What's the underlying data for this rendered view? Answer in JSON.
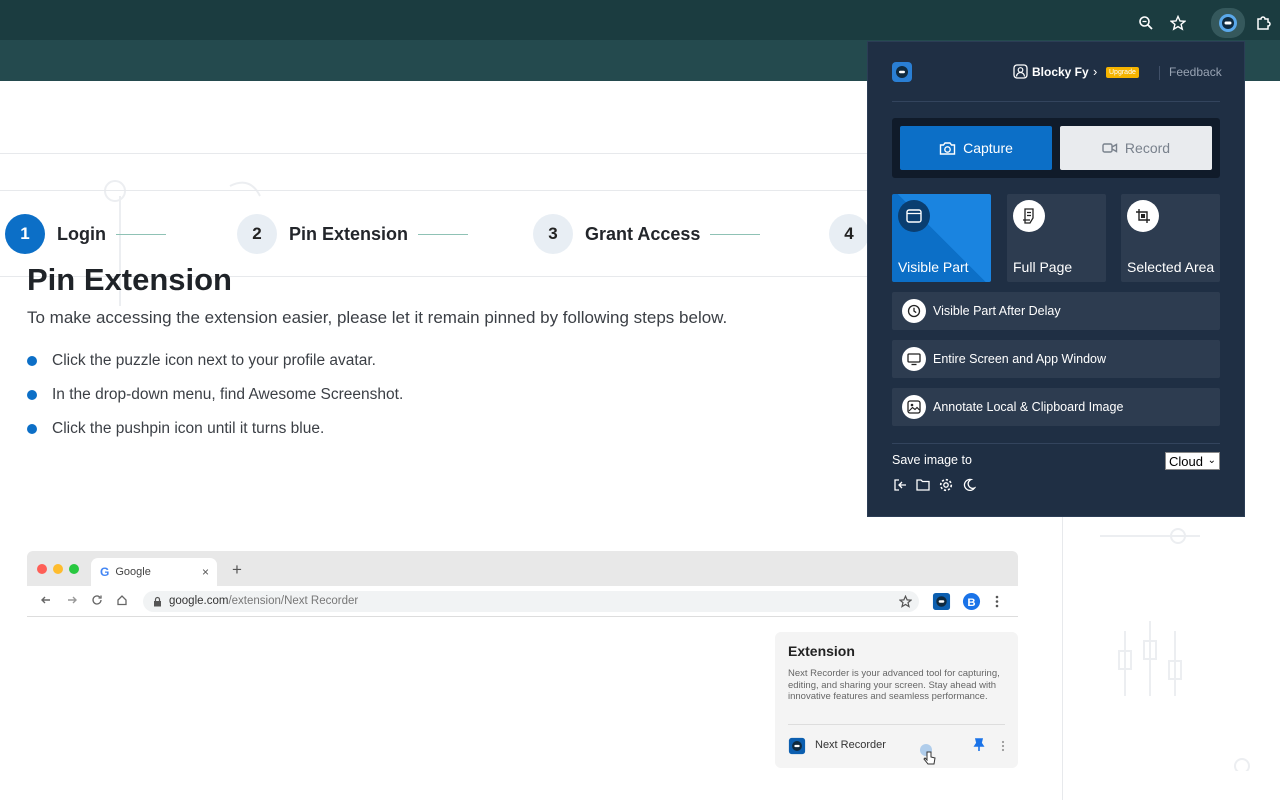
{
  "browser": {
    "icons": [
      "zoom-icon",
      "star-icon",
      "awesome-screenshot-extension-icon",
      "puzzle-icon"
    ]
  },
  "stepper": {
    "steps": [
      {
        "num": "1",
        "label": "Login"
      },
      {
        "num": "2",
        "label": "Pin Extension"
      },
      {
        "num": "3",
        "label": "Grant Access"
      },
      {
        "num": "4",
        "label": ""
      }
    ]
  },
  "content": {
    "title": "Pin Extension",
    "subtitle": "To make accessing the extension easier, please let it remain pinned by following steps below.",
    "bullets": [
      "Click the puzzle icon next to your profile avatar.",
      "In the drop-down menu, find Awesome Screenshot.",
      "Click the pushpin icon until it turns blue."
    ]
  },
  "illustration": {
    "tab_title": "Google",
    "tab_glyph": "G",
    "tab_close": "×",
    "new_tab": "+",
    "url_domain": "google.com",
    "url_path": "/extension/Next Recorder",
    "card_title": "Extension",
    "card_desc": "Next Recorder is your advanced tool for capturing, editing, and sharing your screen. Stay ahead with innovative features and seamless performance.",
    "card_app": "Next Recorder"
  },
  "popup": {
    "brand": "",
    "user": "Blocky Fy",
    "chevron": "›",
    "upgrade": "Upgrade",
    "feedback": "Feedback",
    "capture": "Capture",
    "record": "Record",
    "tiles": [
      "Visible Part",
      "Full Page",
      "Selected Area"
    ],
    "rows": [
      "Visible Part After Delay",
      "Entire Screen and App Window",
      "Annotate Local & Clipboard Image"
    ],
    "save_label": "Save image to",
    "save_value": "Cloud",
    "dropdown_arrow": "⌄"
  },
  "colors": {
    "accent": "#0c6fc7",
    "toolbar": "#1b3c40",
    "popup_bg": "#1f2f44",
    "upgrade": "#f6b400"
  }
}
